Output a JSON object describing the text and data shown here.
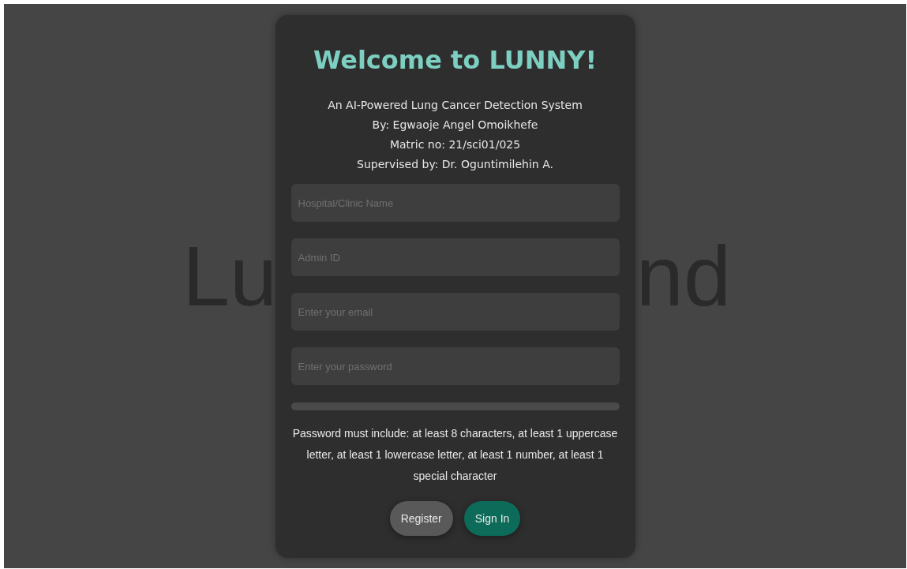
{
  "background_text": [
    "Lu",
    "nd"
  ],
  "card": {
    "title": "Welcome to LUNNY!",
    "subtitle_lines": [
      "An AI-Powered Lung Cancer Detection System",
      "By: Egwaoje Angel Omoikhefe",
      "Matric no: 21/sci01/025",
      "Supervised by: Dr. Oguntimilehin A."
    ],
    "fields": [
      {
        "placeholder": "Hospital/Clinic Name"
      },
      {
        "placeholder": "Admin ID"
      },
      {
        "placeholder": "Enter your email"
      },
      {
        "placeholder": "Enter your password"
      }
    ],
    "password_hint": "Password must include: at least 8 characters, at least 1 uppercase letter, at least 1 lowercase letter, at least 1 number, at least 1 special character",
    "buttons": [
      {
        "label": "Register",
        "kind": "secondary"
      },
      {
        "label": "Sign In",
        "kind": "primary"
      }
    ]
  }
}
